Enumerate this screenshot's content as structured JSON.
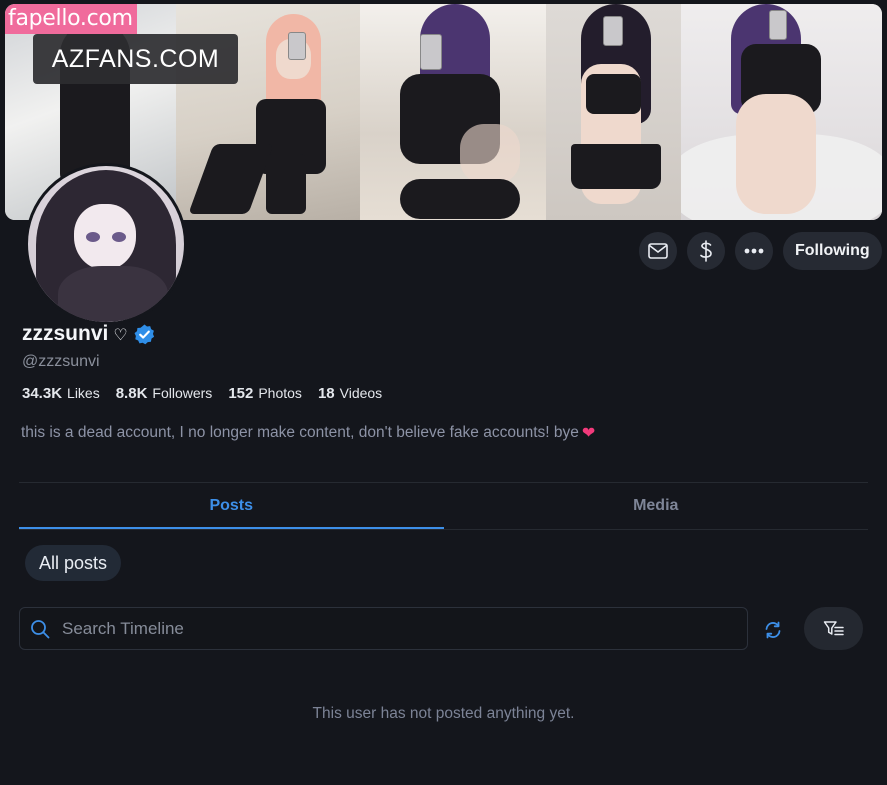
{
  "watermarks": {
    "top_left": "fapello.com",
    "badge": "AZFANS.COM"
  },
  "profile": {
    "display_name": "zzzsunvi",
    "name_suffix": "♡",
    "verified": true,
    "handle": "@zzzsunvi",
    "bio": "this is a dead account, I no longer make content, don't believe fake accounts! bye",
    "bio_emoji": "❤"
  },
  "actions": {
    "message_icon": "mail-icon",
    "tip_icon": "dollar-icon",
    "more_icon": "ellipsis-icon",
    "follow_label": "Following"
  },
  "stats": [
    {
      "value": "34.3K",
      "label": "Likes"
    },
    {
      "value": "8.8K",
      "label": "Followers"
    },
    {
      "value": "152",
      "label": "Photos"
    },
    {
      "value": "18",
      "label": "Videos"
    }
  ],
  "tabs": [
    {
      "label": "Posts",
      "active": true
    },
    {
      "label": "Media",
      "active": false
    }
  ],
  "filter_pill": "All posts",
  "search": {
    "placeholder": "Search Timeline",
    "icon": "search-icon"
  },
  "toolbar_icons": {
    "refresh": "refresh-icon",
    "filter": "filter-icon"
  },
  "empty_state": "This user has not posted anything yet.",
  "colors": {
    "background": "#14161c",
    "accent": "#3d8fe8",
    "watermark_pink": "#f06b9c",
    "heart": "#f23a7b"
  }
}
